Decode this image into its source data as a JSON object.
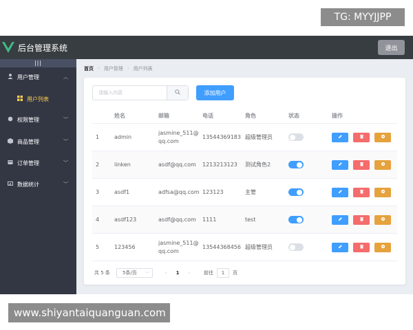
{
  "watermarks": {
    "top": "TG: MYYJJPP",
    "bottom": "www.shiyantaiquanguan.com"
  },
  "header": {
    "title": "后台管理系统",
    "logout_label": "退出"
  },
  "sidebar": {
    "toggle_label": "|||",
    "items": [
      {
        "label": "用户管理",
        "icon": "user-icon",
        "expanded": true
      },
      {
        "label": "权限管理",
        "icon": "lock-icon"
      },
      {
        "label": "商品管理",
        "icon": "goods-icon"
      },
      {
        "label": "订单管理",
        "icon": "order-icon"
      },
      {
        "label": "数据统计",
        "icon": "chart-icon"
      }
    ],
    "sub_items": [
      {
        "label": "用户列表",
        "icon": "grid-icon",
        "active": true
      }
    ],
    "colors": {
      "background": "#333744",
      "active_text": "#ffd04b"
    }
  },
  "breadcrumb": [
    "首页",
    "用户管理",
    "用户列表"
  ],
  "toolbar": {
    "search_placeholder": "请输入内容",
    "add_label": "添加用户"
  },
  "table": {
    "columns": [
      "",
      "姓名",
      "邮箱",
      "电话",
      "角色",
      "状态",
      "操作"
    ],
    "rows": [
      {
        "index": "1",
        "name": "admin",
        "email": "jasmine_511@qq.com",
        "phone": "13544369183",
        "role": "超级管理员",
        "state": false
      },
      {
        "index": "2",
        "name": "linken",
        "email": "asdf@qq.com",
        "phone": "1213213123",
        "role": "测试角色2",
        "state": true
      },
      {
        "index": "3",
        "name": "asdf1",
        "email": "adfsa@qq.com",
        "phone": "123123",
        "role": "主管",
        "state": true
      },
      {
        "index": "4",
        "name": "asdf123",
        "email": "asdf@qq.com",
        "phone": "1111",
        "role": "test",
        "state": true
      },
      {
        "index": "5",
        "name": "123456",
        "email": "jasmine_511@qq.com",
        "phone": "13544368456",
        "role": "超级管理员",
        "state": false
      }
    ]
  },
  "pagination": {
    "total_label": "共 5 条",
    "page_size_label": "5条/页",
    "current_page": "1",
    "goto_prefix": "前往",
    "goto_value": "1",
    "goto_suffix": "页"
  },
  "colors": {
    "primary": "#409eff",
    "danger": "#f56c6c",
    "warning": "#e6a23c",
    "header": "#373d41"
  }
}
